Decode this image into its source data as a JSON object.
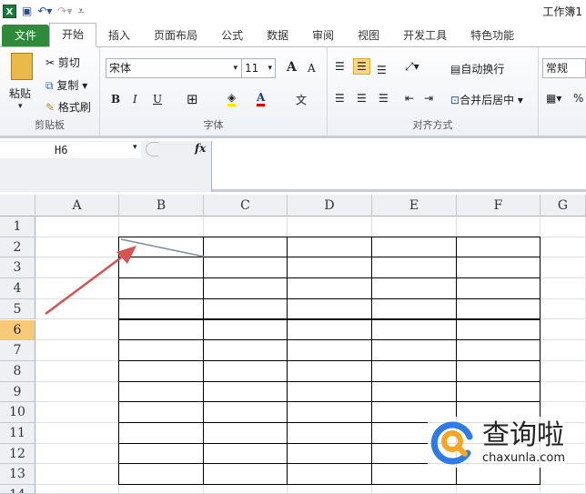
{
  "title": "工作簿1",
  "tabs": [
    "文件",
    "开始",
    "插入",
    "页面布局",
    "公式",
    "数据",
    "审阅",
    "视图",
    "开发工具",
    "特色功能"
  ],
  "clipboard": {
    "paste": "粘贴",
    "cut": "剪切",
    "copy": "复制",
    "format_painter": "格式刷",
    "label": "剪贴板"
  },
  "font": {
    "name": "宋体",
    "size": "11",
    "bold": "B",
    "italic": "I",
    "underline": "U",
    "grow": "A",
    "shrink": "A",
    "color_a": "A",
    "pinyin": "文",
    "label": "字体"
  },
  "alignment": {
    "wrap": "自动换行",
    "merge": "合并后居中",
    "label": "对齐方式"
  },
  "number": {
    "format": "常规",
    "percent": "%"
  },
  "formula_bar": {
    "name_box": "H6",
    "fx": "fx",
    "value": ""
  },
  "columns": [
    "A",
    "B",
    "C",
    "D",
    "E",
    "F",
    "G"
  ],
  "rows": [
    "1",
    "2",
    "3",
    "4",
    "5",
    "6",
    "7",
    "8",
    "9",
    "10",
    "11",
    "12",
    "13",
    "14"
  ],
  "selected_row": "6",
  "watermark": {
    "brand": "查询啦",
    "site": "chaxunla.com"
  },
  "colors": {
    "file_tab": "#2f8a3c",
    "arrow": "#d9534f",
    "selected_header": "#f9c97a"
  }
}
